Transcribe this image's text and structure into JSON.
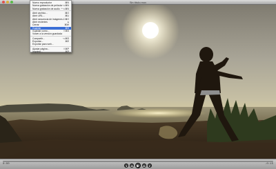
{
  "window": {
    "title": "Sin título.mov"
  },
  "menu": {
    "groups": [
      [
        {
          "label": "Nuevo reproductor",
          "shortcut": "⌘N"
        },
        {
          "label": "Nueva grabación de película",
          "shortcut": "⌥⌘N"
        },
        {
          "label": "Nueva grabación de audio",
          "shortcut": "^⌥⌘N"
        }
      ],
      [
        {
          "label": "Abrir archivo...",
          "shortcut": "⌘O"
        },
        {
          "label": "Abrir URL...",
          "shortcut": "⌘U"
        },
        {
          "label": "Abrir secuencia de imágenes...",
          "shortcut": "⇧⌘O"
        },
        {
          "label": "Abrir recientes",
          "shortcut": "▸"
        },
        {
          "label": "Cerrar",
          "shortcut": "⌘W"
        },
        {
          "label": "Guardar",
          "shortcut": "⌘S",
          "active": true
        },
        {
          "label": "Guardar como...",
          "shortcut": "⇧⌘S"
        },
        {
          "label": "Volver a la versión guardada",
          "shortcut": ""
        }
      ],
      [
        {
          "label": "Compartir...",
          "shortcut": "⌥⌘S"
        },
        {
          "label": "Exportar...",
          "shortcut": "⌘E"
        },
        {
          "label": "Exportar para web...",
          "shortcut": ""
        }
      ],
      [
        {
          "label": "Ajustar página...",
          "shortcut": "⇧⌘P"
        },
        {
          "label": "Imprimir...",
          "shortcut": "⌘P"
        }
      ]
    ]
  },
  "controls": {
    "time_elapsed": "0:00",
    "time_remaining": "-0:15",
    "progress_percent": 2,
    "buttons": [
      {
        "name": "volume-down-icon",
        "glyph": "◂"
      },
      {
        "name": "rewind-icon",
        "glyph": "◂◂"
      },
      {
        "name": "play-icon",
        "glyph": "▶"
      },
      {
        "name": "fast-forward-icon",
        "glyph": "▸▸"
      },
      {
        "name": "volume-up-icon",
        "glyph": "▸"
      }
    ]
  }
}
